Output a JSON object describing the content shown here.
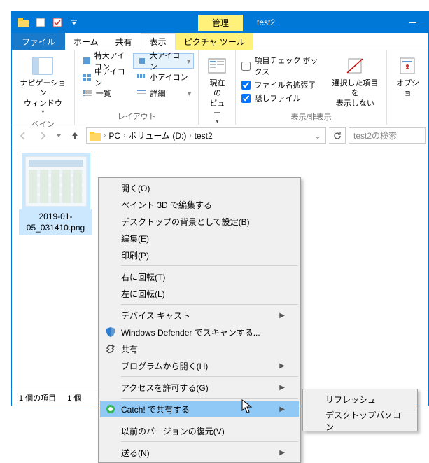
{
  "titlebar": {
    "manage_tab": "管理",
    "title": "test2"
  },
  "tabs": {
    "file": "ファイル",
    "home": "ホーム",
    "share": "共有",
    "view": "表示",
    "picture_tool": "ピクチャ ツール"
  },
  "ribbon": {
    "pane": {
      "nav": "ナビゲーション\nウィンドウ",
      "label": "ペイン"
    },
    "layout": {
      "extra_large": "特大アイコン",
      "large": "大アイコン",
      "medium": "中アイコン",
      "small": "小アイコン",
      "list": "一覧",
      "details": "詳細",
      "label": "レイアウト"
    },
    "current_view": {
      "btn": "現在の\nビュー"
    },
    "show_hide": {
      "checkboxes": "項目チェック ボックス",
      "extensions": "ファイル名拡張子",
      "hidden": "隠しファイル",
      "hide_selected": "選択した項目を\n表示しない",
      "label": "表示/非表示"
    },
    "options": {
      "btn": "オプショ"
    }
  },
  "breadcrumb": {
    "pc": "PC",
    "vol": "ボリューム (D:)",
    "folder": "test2"
  },
  "search": {
    "placeholder": "test2の検索"
  },
  "file": {
    "name": "2019-01-05_031410.png"
  },
  "status": {
    "items": "1 個の項目",
    "selected": "1 個"
  },
  "context": {
    "open": "開く(O)",
    "paint3d": "ペイント 3D で編集する",
    "wallpaper": "デスクトップの背景として設定(B)",
    "edit": "編集(E)",
    "print": "印刷(P)",
    "rotate_r": "右に回転(T)",
    "rotate_l": "左に回転(L)",
    "cast": "デバイス キャスト",
    "defender": "Windows Defender でスキャンする...",
    "share": "共有",
    "open_with": "プログラムから開く(H)",
    "access": "アクセスを許可する(G)",
    "catch": "Catch! で共有する",
    "prev_ver": "以前のバージョンの復元(V)",
    "send_to": "送る(N)"
  },
  "submenu": {
    "refresh": "リフレッシュ",
    "desktop_pc": "デスクトップパソコン"
  }
}
